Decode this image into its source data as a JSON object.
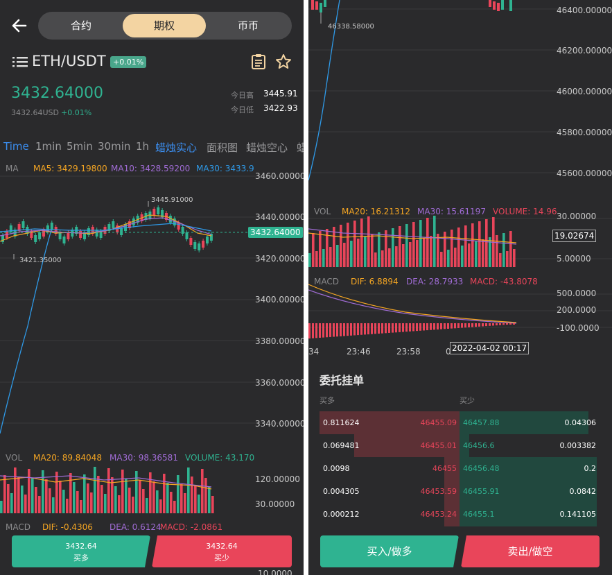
{
  "header": {
    "tabs": [
      "合约",
      "期权",
      "币币"
    ],
    "active_tab": "期权"
  },
  "ticker": {
    "pair": "ETH/USDT",
    "change_badge": "+0.01%",
    "price": "3432.64000",
    "price_usd": "3432.64USD",
    "change": "+0.01%",
    "high_label": "今日高",
    "high": "3445.91",
    "low_label": "今日低",
    "low": "3422.93"
  },
  "timeframes": [
    "Time",
    "1min",
    "5min",
    "30min",
    "1h",
    "蜡烛实心",
    "面积图",
    "蜡烛空心",
    "蜡"
  ],
  "main_chart": {
    "ma_label": "MA",
    "ma5": "MA5: 3429.19800",
    "ma10": "MA10: 3428.59200",
    "ma30": "MA30: 3433.9",
    "y_ticks": [
      "3460.00000",
      "3440.00000",
      "3420.00000",
      "3400.00000",
      "3380.00000",
      "3360.00000",
      "3340.00000"
    ],
    "current_price_tag": "3432.64000",
    "max_label": "3445.91000",
    "min_label": "3421.35000"
  },
  "vol_left": {
    "vol": "VOL",
    "ma20": "MA20: 89.84048",
    "ma30": "MA30: 98.36581",
    "volume": "VOLUME: 43.170",
    "ticks": [
      "120.00000",
      "30.00000"
    ]
  },
  "macd_left": {
    "label": "MACD",
    "dif": "DIF: -0.4306",
    "dea": "DEA: 0.6124",
    "macd": "MACD: -2.0861",
    "tick": "10.0000"
  },
  "left_buttons": {
    "buy_price": "3432.64",
    "buy_label": "买多",
    "sell_price": "3432.64",
    "sell_label": "买少"
  },
  "right_chart": {
    "y_ticks": [
      "46400.00000",
      "46200.00000",
      "46000.00000",
      "45800.00000",
      "45600.00000"
    ],
    "min_label": "46338.58000",
    "vol": "VOL",
    "ma20": "MA20: 16.21312",
    "ma30": "MA30: 15.61197",
    "volume": "VOLUME: 14.96",
    "vol_ticks": [
      "30.00000",
      "5.00000"
    ],
    "vol_tag": "19.02674",
    "macd": "MACD",
    "dif": "DIF: 6.8894",
    "dea": "DEA: 28.7933",
    "macd_val": "MACD: -43.8078",
    "macd_ticks": [
      "500.0000",
      "200.0000",
      "-100.0000"
    ],
    "x_ticks": [
      "34",
      "23:46",
      "23:58",
      "0"
    ],
    "crosshair_time": "2022-04-02 00:17"
  },
  "orderbook": {
    "title": "委托挂单",
    "buy_head": "买多",
    "sell_head": "买少",
    "rows": [
      {
        "bq": "0.811624",
        "bp": "46455.09",
        "sp": "46457.88",
        "sq": "0.04306"
      },
      {
        "bq": "0.069481",
        "bp": "46455.01",
        "sp": "46456.6",
        "sq": "0.003382"
      },
      {
        "bq": "0.0098",
        "bp": "46455",
        "sp": "46456.48",
        "sq": "0.2"
      },
      {
        "bq": "0.004305",
        "bp": "46453.59",
        "sp": "46455.91",
        "sq": "0.0842"
      },
      {
        "bq": "0.000212",
        "bp": "46453.24",
        "sp": "46455.1",
        "sq": "0.141105"
      }
    ],
    "buy_button": "买入/做多",
    "sell_button": "卖出/做空"
  },
  "colors": {
    "bg": "#2a2a2c",
    "up": "#2fb391",
    "down": "#e9455a",
    "accent": "#f3d4a2",
    "ma5": "#f5a623",
    "ma10": "#a06cd5",
    "ma30": "#2f9ae8"
  }
}
